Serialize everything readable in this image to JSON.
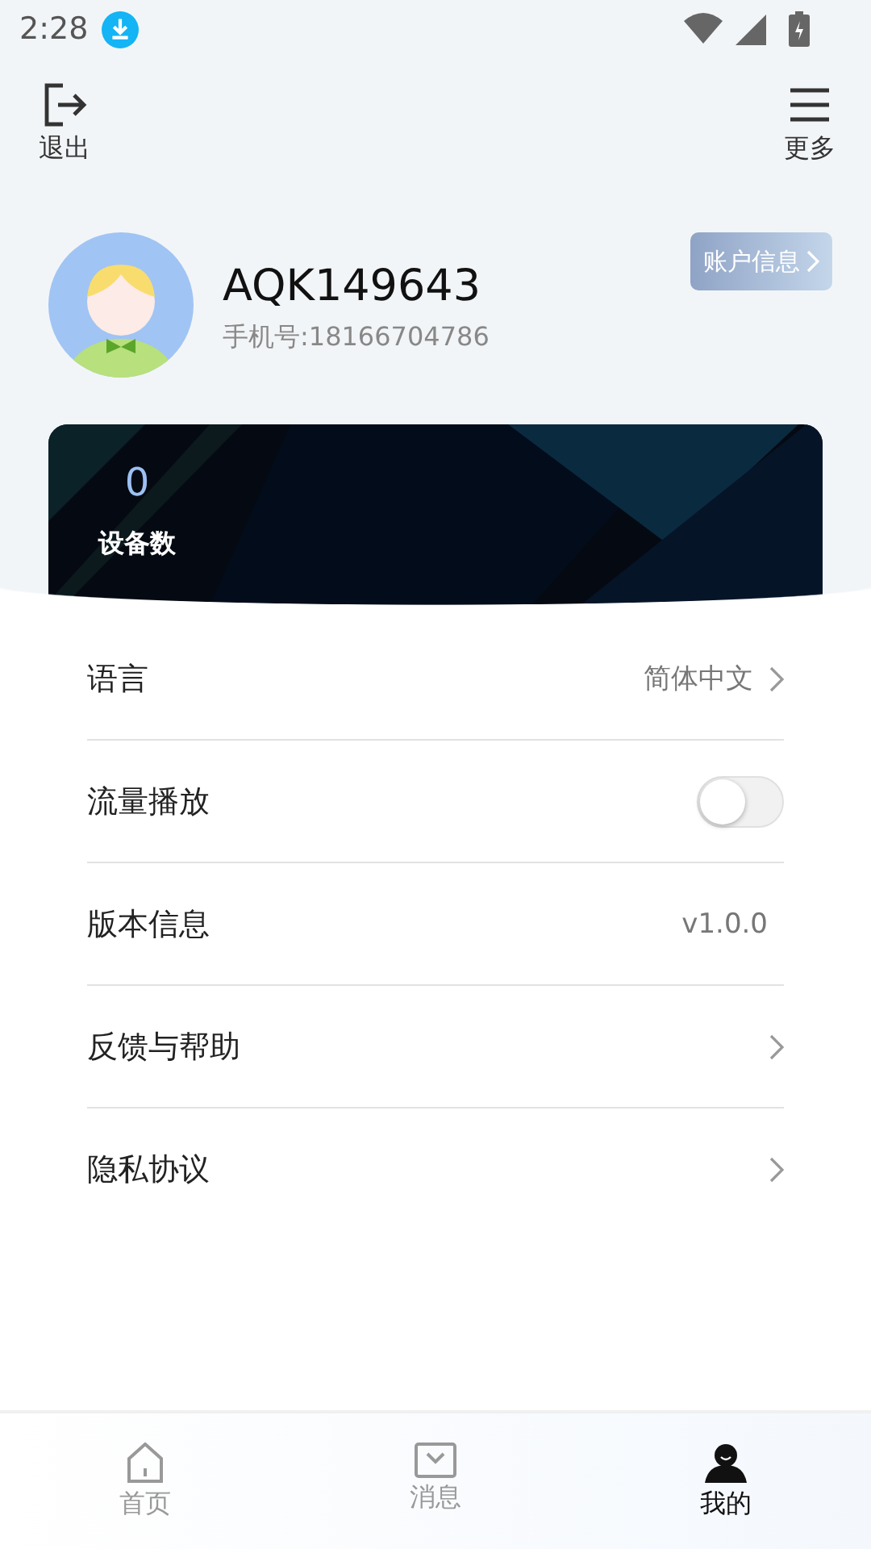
{
  "status_bar": {
    "time": "2:28"
  },
  "toolbar": {
    "left": {
      "label": "退出"
    },
    "right": {
      "label": "更多"
    }
  },
  "profile": {
    "username": "AQK149643",
    "phone": "手机号:18166704786",
    "account_button": "账户信息"
  },
  "device_card": {
    "count": "0",
    "label": "设备数"
  },
  "settings": [
    {
      "kind": "link",
      "label": "语言",
      "value": "简体中文"
    },
    {
      "kind": "toggle",
      "label": "流量播放",
      "on": false
    },
    {
      "kind": "text",
      "label": "版本信息",
      "value": "v1.0.0"
    },
    {
      "kind": "link",
      "label": "反馈与帮助"
    },
    {
      "kind": "link",
      "label": "隐私协议"
    }
  ],
  "tabs": [
    {
      "kind": "home",
      "label": "首页",
      "selected": false
    },
    {
      "kind": "message",
      "label": "消息",
      "selected": false
    },
    {
      "kind": "profile",
      "label": "我的",
      "selected": true
    }
  ]
}
